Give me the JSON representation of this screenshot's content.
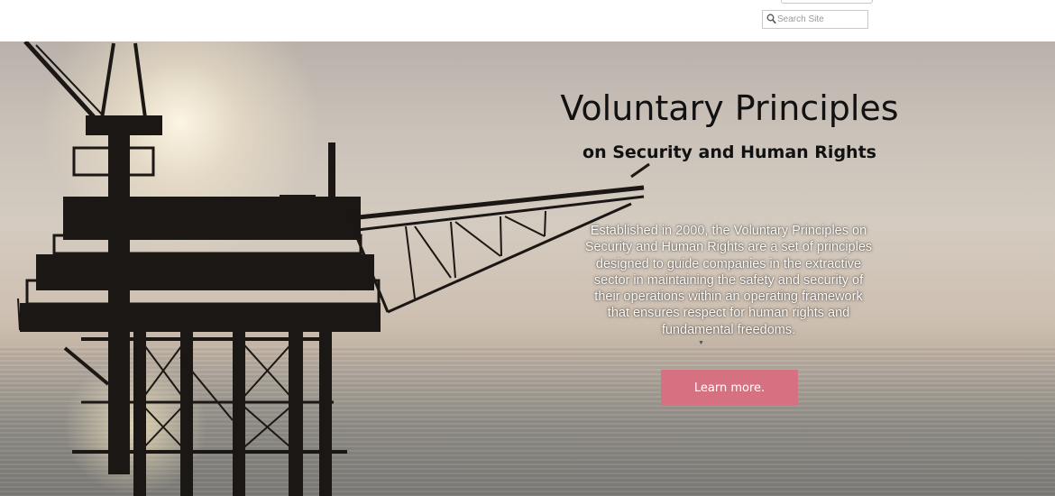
{
  "header": {
    "search": {
      "placeholder": "Search Site",
      "icon": "search-icon"
    }
  },
  "hero": {
    "title": "Voluntary Principles",
    "subtitle": "on Security and Human Rights",
    "description": "Established in 2000, the Voluntary Principles on Security and Human Rights are a set of principles designed to guide companies in the extractive sector in maintaining the safety and security of their operations within an operating framework that ensures respect for human rights and fundamental freedoms.",
    "cta_label": "Learn more.",
    "background_image": "offshore oil rig silhouette at sunset over sea"
  },
  "colors": {
    "cta_background": "#d67182",
    "title_text": "#111111",
    "description_text": "#ffffff"
  }
}
